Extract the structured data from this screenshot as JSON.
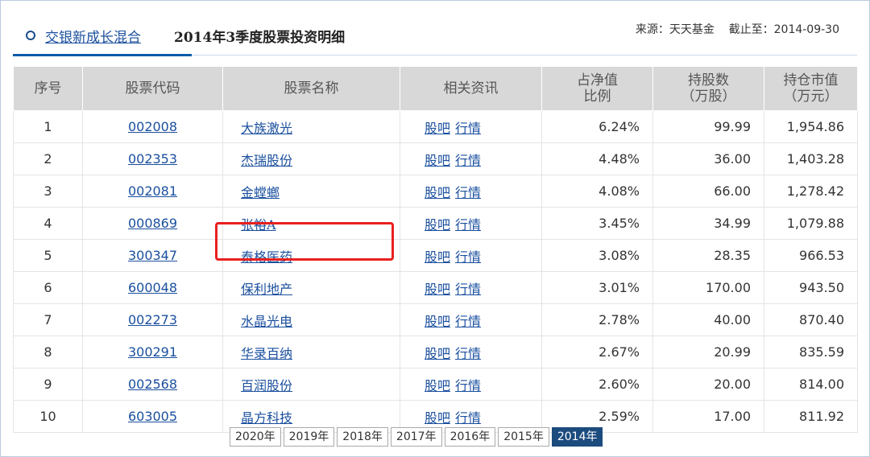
{
  "header": {
    "fund_name": "交银新成长混合",
    "period_title": "2014年3季度股票投资明细",
    "source_text": "来源：天天基金    截止至：2014-09-30"
  },
  "columns": [
    "序号",
    "股票代码",
    "股票名称",
    "相关资讯",
    "占净值\n比例",
    "持股数\n（万股）",
    "持仓市值\n（万元）"
  ],
  "rows": [
    {
      "no": "1",
      "code": "002008",
      "name": "大族激光",
      "news1": "股吧",
      "news2": "行情",
      "ratio": "6.24%",
      "shares": "99.99",
      "value": "1,954.86"
    },
    {
      "no": "2",
      "code": "002353",
      "name": "杰瑞股份",
      "news1": "股吧",
      "news2": "行情",
      "ratio": "4.48%",
      "shares": "36.00",
      "value": "1,403.28"
    },
    {
      "no": "3",
      "code": "002081",
      "name": "金螳螂",
      "news1": "股吧",
      "news2": "行情",
      "ratio": "4.08%",
      "shares": "66.00",
      "value": "1,278.42"
    },
    {
      "no": "4",
      "code": "000869",
      "name": "张裕A",
      "news1": "股吧",
      "news2": "行情",
      "ratio": "3.45%",
      "shares": "34.99",
      "value": "1,079.88"
    },
    {
      "no": "5",
      "code": "300347",
      "name": "泰格医药",
      "news1": "股吧",
      "news2": "行情",
      "ratio": "3.08%",
      "shares": "28.35",
      "value": "966.53"
    },
    {
      "no": "6",
      "code": "600048",
      "name": "保利地产",
      "news1": "股吧",
      "news2": "行情",
      "ratio": "3.01%",
      "shares": "170.00",
      "value": "943.50"
    },
    {
      "no": "7",
      "code": "002273",
      "name": "水晶光电",
      "news1": "股吧",
      "news2": "行情",
      "ratio": "2.78%",
      "shares": "40.00",
      "value": "870.40"
    },
    {
      "no": "8",
      "code": "300291",
      "name": "华录百纳",
      "news1": "股吧",
      "news2": "行情",
      "ratio": "2.67%",
      "shares": "20.99",
      "value": "835.59"
    },
    {
      "no": "9",
      "code": "002568",
      "name": "百润股份",
      "news1": "股吧",
      "news2": "行情",
      "ratio": "2.60%",
      "shares": "20.00",
      "value": "814.00"
    },
    {
      "no": "10",
      "code": "603005",
      "name": "晶方科技",
      "news1": "股吧",
      "news2": "行情",
      "ratio": "2.59%",
      "shares": "17.00",
      "value": "811.92"
    }
  ],
  "years": [
    "2020年",
    "2019年",
    "2018年",
    "2017年",
    "2016年",
    "2015年",
    "2014年"
  ],
  "active_year": "2014年",
  "colors": {
    "accent": "#0f5ba8",
    "link": "#1a4f9e",
    "highlight": "#e8201f",
    "active_year_bg": "#1c4b7e",
    "header_bg": "#d8d8d8"
  }
}
